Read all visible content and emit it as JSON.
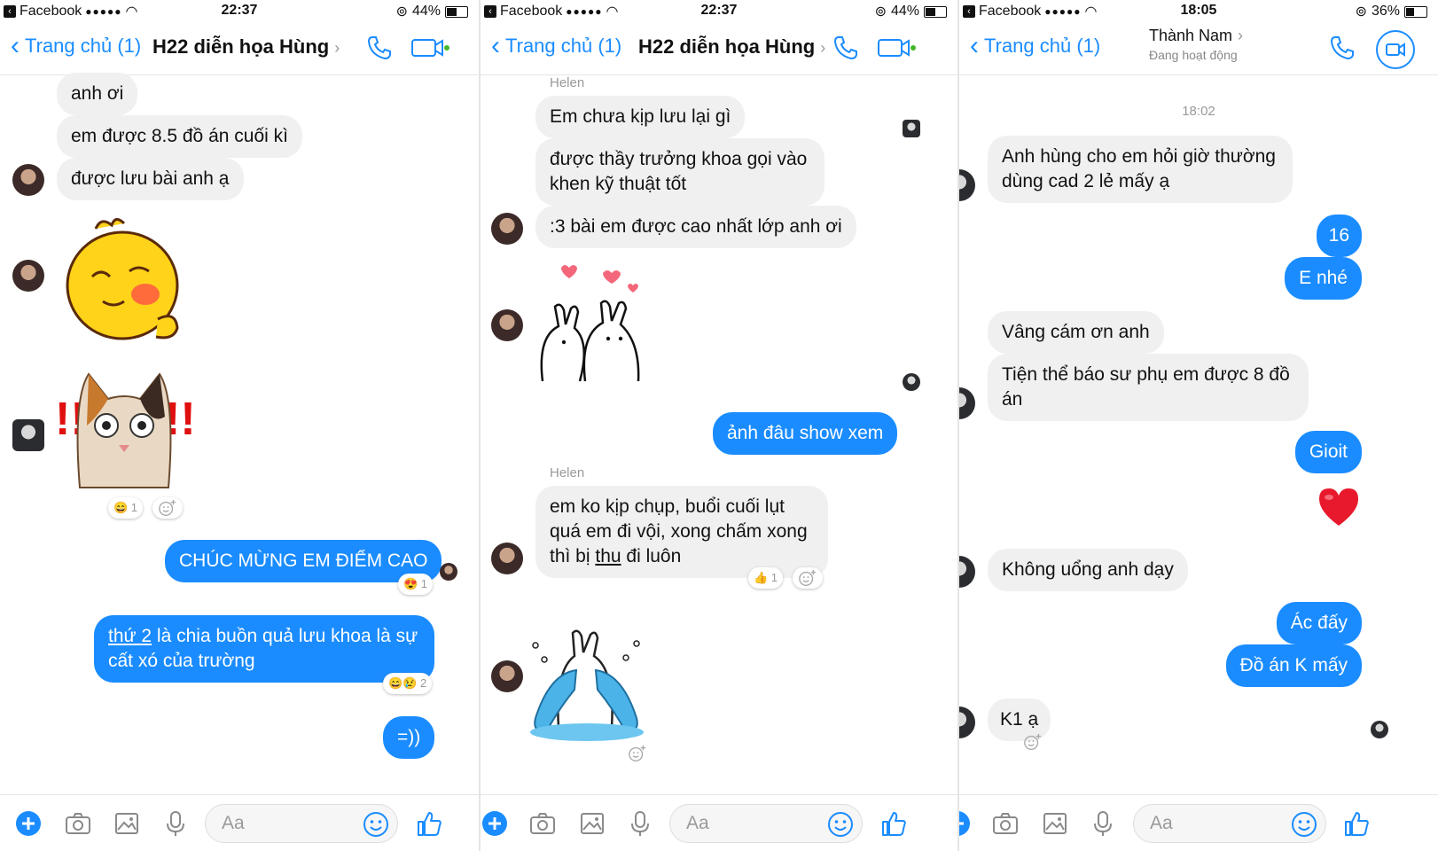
{
  "colors": {
    "accent": "#1a8cff",
    "incoming_bubble": "#f1f0f0",
    "outgoing_bubble": "#1a8cff"
  },
  "panel1": {
    "status": {
      "app": "Facebook",
      "signal": "●●●●●",
      "time": "22:37",
      "battery": "44%"
    },
    "nav": {
      "back": "Trang chủ (1)",
      "title": "H22 diễn họa Hùng"
    },
    "messages": {
      "m1": "anh ơi",
      "m2": "em được 8.5 đồ án cuối kì",
      "m3": "được lưu bài anh ạ",
      "r1": "😄 1",
      "o1": "CHÚC MỪNG EM ĐIỂM CAO",
      "r2": "😍 1",
      "o2_link": "thứ 2",
      "o2_rest": " là chia buồn quả lưu khoa là sự cất xó của trường",
      "r3": "😄😢 2",
      "o3": "=))"
    },
    "composer": {
      "placeholder": "Aa"
    }
  },
  "panel2": {
    "status": {
      "app": "Facebook",
      "signal": "●●●●●",
      "time": "22:37",
      "battery": "44%"
    },
    "nav": {
      "back": "Trang chủ (1)",
      "title": "H22 diễn họa Hùng"
    },
    "messages": {
      "sender1": "Helen",
      "m1": "Em chưa kịp lưu lại gì",
      "m2": "được thầy trưởng khoa gọi vào khen kỹ thuật tốt",
      "m3": ":3 bài em được cao nhất lớp anh ơi",
      "o1": "ảnh đâu show xem",
      "sender2": "Helen",
      "m4_start": "em ko kịp chụp, buổi cuối lụt quá em đi vội, xong chấm xong thì bị ",
      "m4_link": "thu",
      "m4_end": " đi luôn",
      "r1": "👍 1"
    },
    "composer": {
      "placeholder": "Aa"
    }
  },
  "panel3": {
    "status": {
      "app": "Facebook",
      "signal": "●●●●●",
      "time": "18:05",
      "battery": "36%"
    },
    "nav": {
      "back": "Trang chủ (1)",
      "title": "Thành Nam",
      "subtitle": "Đang hoạt động"
    },
    "messages": {
      "timestamp": "18:02",
      "m1": "Anh hùng cho em hỏi giờ thường dùng cad 2 lẻ mấy ạ",
      "o1": "16",
      "o2": "E nhé",
      "m2": "Vâng cám ơn anh",
      "m3": "Tiện thể báo sư phụ em được 8 đồ án",
      "o3": "Gioit",
      "m4": "Không uổng anh dạy",
      "o4": "Ác đấy",
      "o5": "Đồ án K mấy",
      "m5": "K1 ạ"
    },
    "composer": {
      "placeholder": "Aa"
    }
  }
}
